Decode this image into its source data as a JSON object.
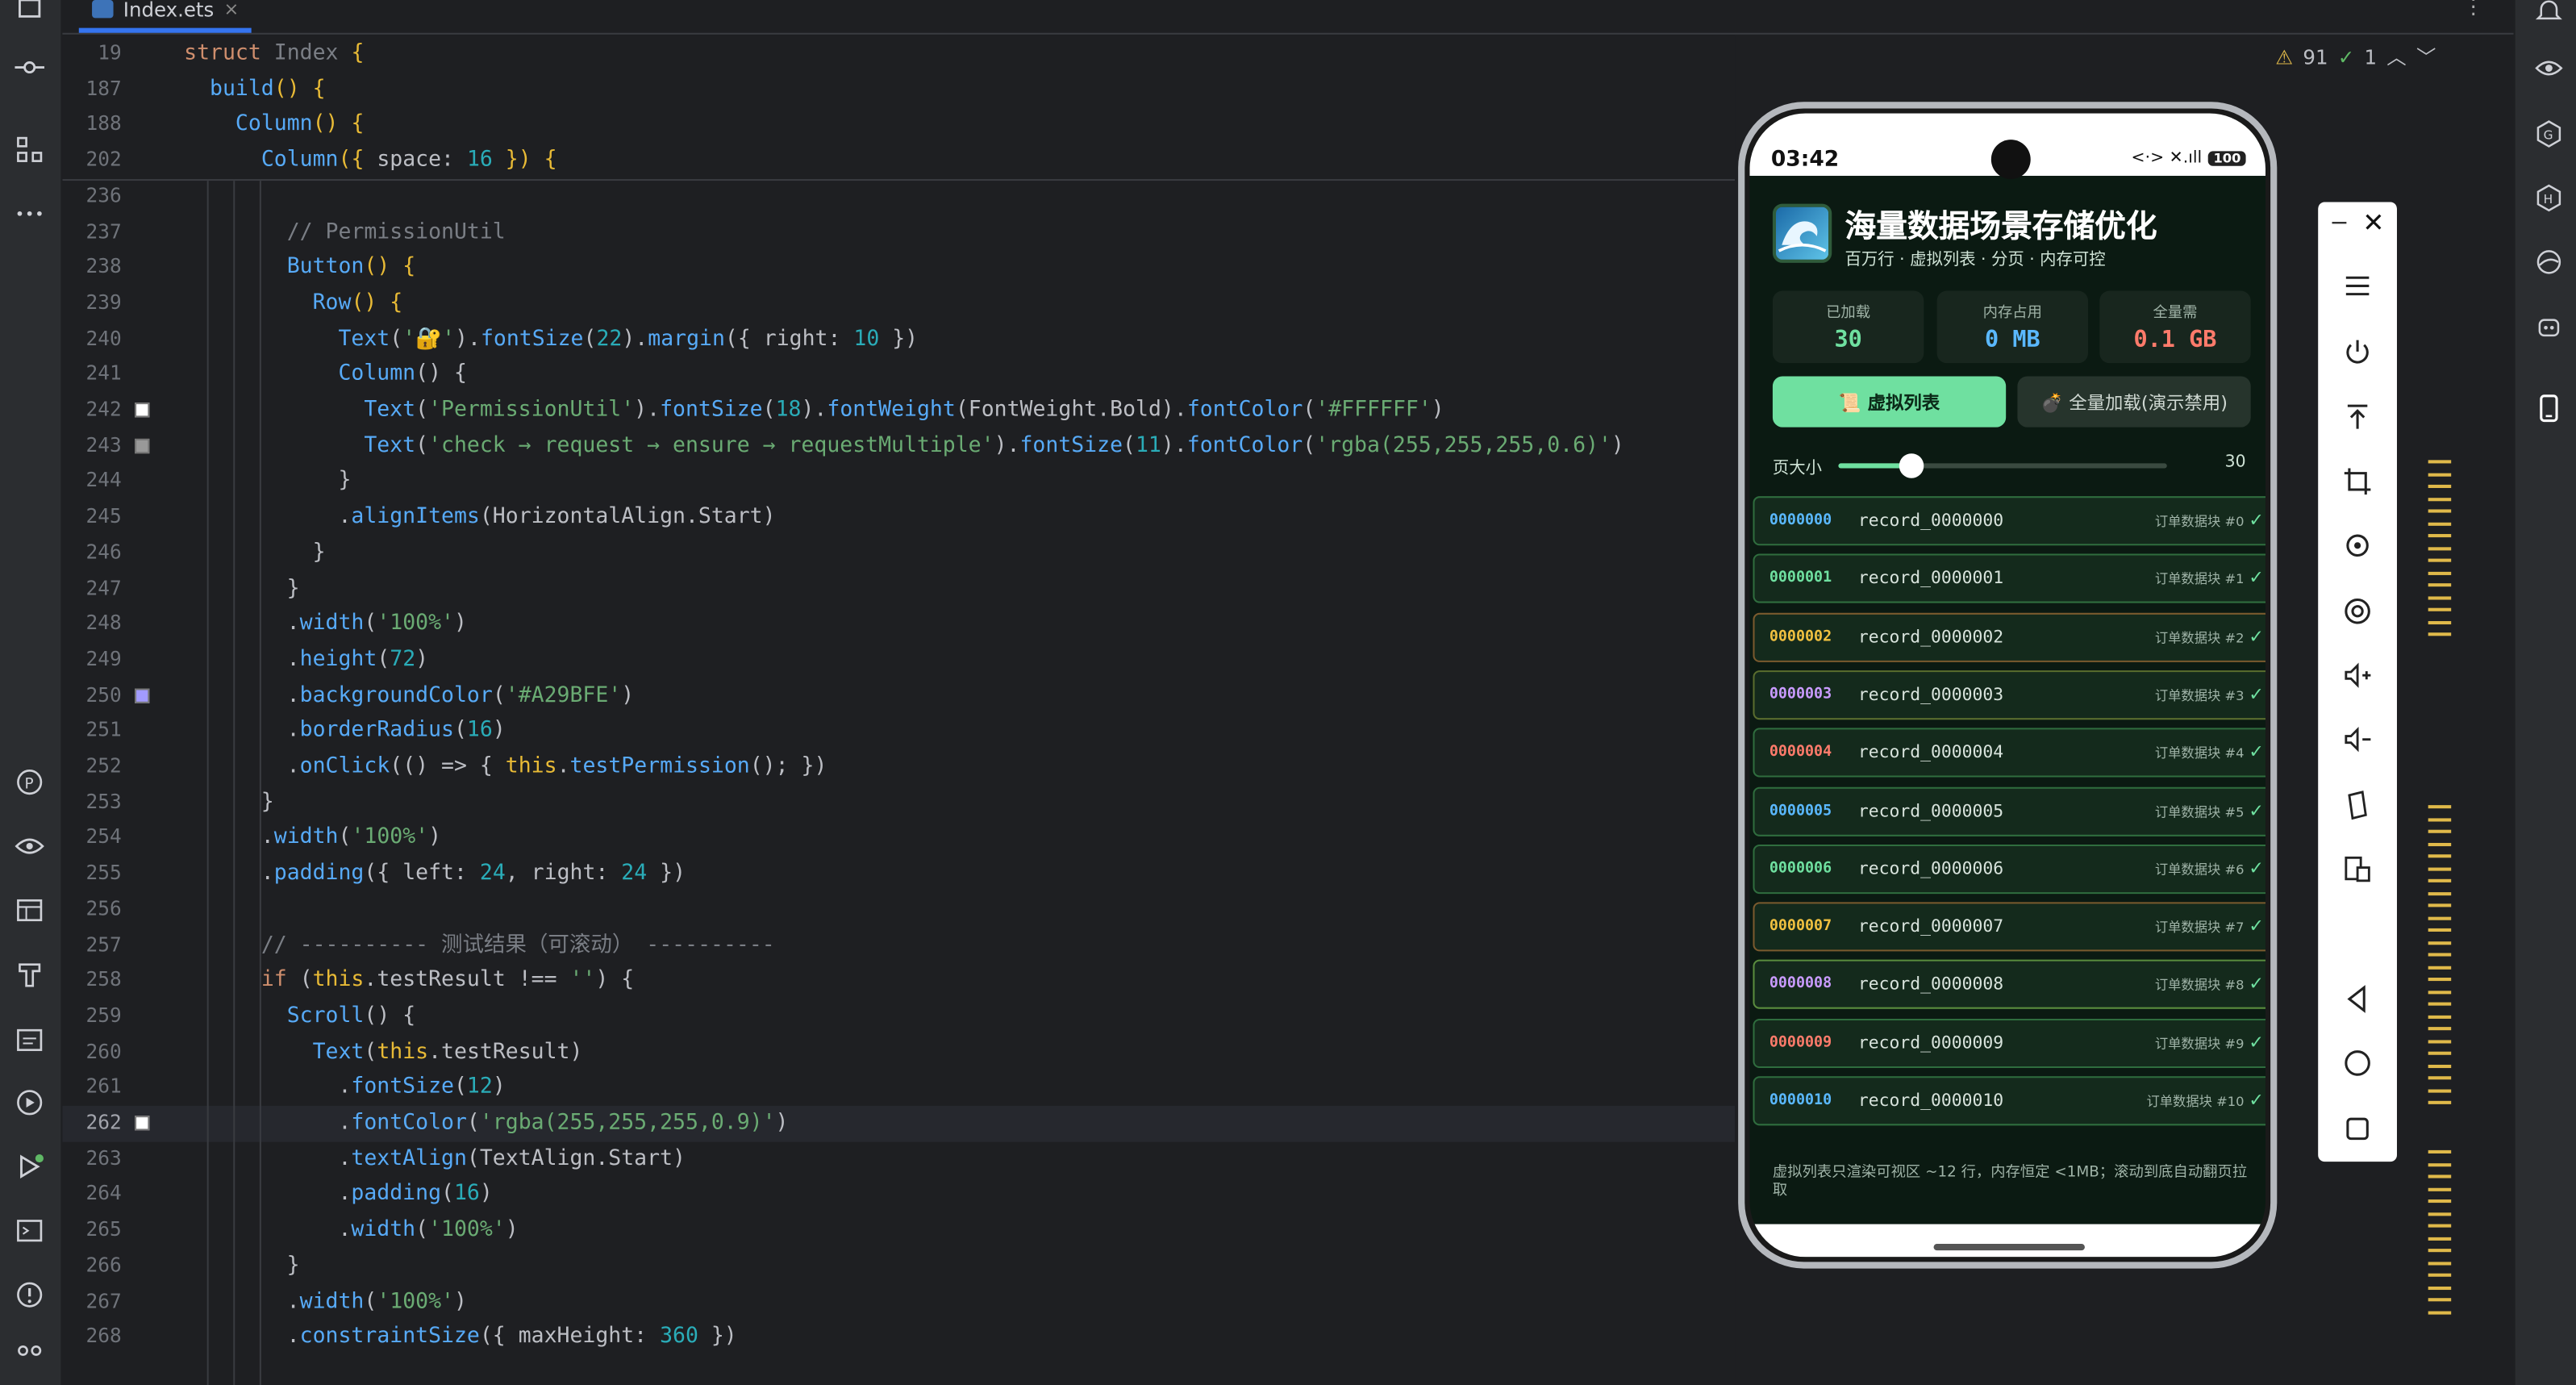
{
  "window": {
    "tab_label": "Index.ets",
    "tab_close": "×",
    "more": "⋮"
  },
  "inspections": {
    "warnings": "91",
    "ok": "1"
  },
  "code_lines": [
    {
      "no": "19",
      "html": "<span class='k'>struct</span> <span class='t'>Index</span> <span class='y'>{</span>"
    },
    {
      "no": "187",
      "html": "  <span class='f'>build</span><span class='y'>()</span> <span class='y'>{</span>"
    },
    {
      "no": "188",
      "html": "    <span class='f'>Column</span><span class='y'>()</span> <span class='y'>{</span>"
    },
    {
      "no": "202",
      "html": "      <span class='f'>Column</span><span class='y'>({</span> space: <span class='n'>16</span> <span class='y'>})</span> <span class='y'>{</span>"
    },
    {
      "no": "236",
      "html": ""
    },
    {
      "no": "237",
      "html": "        <span class='c'>// PermissionUtil</span>"
    },
    {
      "no": "238",
      "html": "        <span class='f'>Button</span><span class='y'>()</span> <span class='y'>{</span>"
    },
    {
      "no": "239",
      "html": "          <span class='f'>Row</span><span class='y'>()</span> <span class='y'>{</span>"
    },
    {
      "no": "240",
      "html": "            <span class='f'>Text</span>(<span class='s'>'🔐'</span>).<span class='f'>fontSize</span>(<span class='n'>22</span>).<span class='f'>margin</span>({ right: <span class='n'>10</span> })"
    },
    {
      "no": "241",
      "html": "            <span class='f'>Column</span>() {"
    },
    {
      "no": "242",
      "html": "              <span class='f'>Text</span>(<span class='s'>'PermissionUtil'</span>).<span class='f'>fontSize</span>(<span class='n'>18</span>).<span class='f'>fontWeight</span>(FontWeight.Bold).<span class='f'>fontColor</span>(<span class='s'>'#FFFFFF'</span>)"
    },
    {
      "no": "243",
      "html": "              <span class='f'>Text</span>(<span class='s'>'check → request → ensure → requestMultiple'</span>).<span class='f'>fontSize</span>(<span class='n'>11</span>).<span class='f'>fontColor</span>(<span class='s'>'rgba(255,255,255,0.6)'</span>)"
    },
    {
      "no": "244",
      "html": "            }"
    },
    {
      "no": "245",
      "html": "            .<span class='f'>alignItems</span>(HorizontalAlign.Start)"
    },
    {
      "no": "246",
      "html": "          }"
    },
    {
      "no": "247",
      "html": "        }"
    },
    {
      "no": "248",
      "html": "        .<span class='f'>width</span>(<span class='s'>'100%'</span>)"
    },
    {
      "no": "249",
      "html": "        .<span class='f'>height</span>(<span class='n'>72</span>)"
    },
    {
      "no": "250",
      "html": "        .<span class='f'>backgroundColor</span>(<span class='s'>'#A29BFE'</span>)"
    },
    {
      "no": "251",
      "html": "        .<span class='f'>borderRadius</span>(<span class='n'>16</span>)"
    },
    {
      "no": "252",
      "html": "        .<span class='f'>onClick</span>(() => { <span class='y'>this</span>.<span class='f'>testPermission</span>(); })"
    },
    {
      "no": "253",
      "html": "      }"
    },
    {
      "no": "254",
      "html": "      .<span class='f'>width</span>(<span class='s'>'100%'</span>)"
    },
    {
      "no": "255",
      "html": "      .<span class='f'>padding</span>({ left: <span class='n'>24</span>, right: <span class='n'>24</span> })"
    },
    {
      "no": "256",
      "html": ""
    },
    {
      "no": "257",
      "html": "      <span class='c'>// ---------- 测试结果（可滚动） ----------</span>"
    },
    {
      "no": "258",
      "html": "      <span class='k'>if</span> (<span class='y'>this</span>.testResult !== <span class='s'>''</span>) {"
    },
    {
      "no": "259",
      "html": "        <span class='f'>Scroll</span>() {"
    },
    {
      "no": "260",
      "html": "          <span class='f'>Text</span>(<span class='y'>this</span>.testResult)"
    },
    {
      "no": "261",
      "html": "            .<span class='f'>fontSize</span>(<span class='n'>12</span>)"
    },
    {
      "no": "262",
      "html": "            .<span class='f'>fontColor</span>(<span class='s'>'rgba(255,255,255,0.9)'</span>)"
    },
    {
      "no": "263",
      "html": "            .<span class='f'>textAlign</span>(TextAlign.Start)"
    },
    {
      "no": "264",
      "html": "            .<span class='f'>padding</span>(<span class='n'>16</span>)"
    },
    {
      "no": "265",
      "html": "            .<span class='f'>width</span>(<span class='s'>'100%'</span>)"
    },
    {
      "no": "266",
      "html": "        }"
    },
    {
      "no": "267",
      "html": "        .<span class='f'>width</span>(<span class='s'>'100%'</span>)"
    },
    {
      "no": "268",
      "html": "        .<span class='f'>constraintSize</span>({ maxHeight: <span class='n'>360</span> })"
    }
  ],
  "gutter_colors": {
    "242": "#FFFFFF",
    "243": "#999999",
    "250": "#A29BFE",
    "262": "#FFFFFF"
  },
  "current_line": "262",
  "phone": {
    "time": "03:42",
    "battery": "100",
    "net": "<·> ✕.ıll",
    "title": "海量数据场景存储优化",
    "subtitle": "百万行 · 虚拟列表 · 分页 · 内存可控",
    "stats": [
      {
        "label": "已加载",
        "value": "30",
        "color": "#6fe0a0"
      },
      {
        "label": "内存占用",
        "value": "0 MB",
        "color": "#5ab8ff"
      },
      {
        "label": "全量需",
        "value": "0.1 GB",
        "color": "#ff7b6b"
      }
    ],
    "btn_virtual": "📜 虚拟列表",
    "btn_full": "💣 全量加载(演示禁用)",
    "page_size_label": "页大小",
    "page_size_value": "30",
    "page_size_fraction": 0.22,
    "rows": [
      {
        "id": "0000000",
        "name": "record_0000000",
        "tag": "订单数据块 #0",
        "check": "✓",
        "color": "#5ab8ff",
        "border": "#2f6d3e"
      },
      {
        "id": "0000001",
        "name": "record_0000001",
        "tag": "订单数据块 #1",
        "check": "✓",
        "color": "#6fe0a0",
        "border": "#2f6d3e"
      },
      {
        "id": "0000002",
        "name": "record_0000002",
        "tag": "订单数据块 #2",
        "check": "✓",
        "color": "#f0c040",
        "border": "#7a5a2e"
      },
      {
        "id": "0000003",
        "name": "record_0000003",
        "tag": "订单数据块 #3",
        "check": "✓",
        "color": "#c99bff",
        "border": "#5a6d2e"
      },
      {
        "id": "0000004",
        "name": "record_0000004",
        "tag": "订单数据块 #4",
        "check": "✓",
        "color": "#ff7b6b",
        "border": "#2f6d3e"
      },
      {
        "id": "0000005",
        "name": "record_0000005",
        "tag": "订单数据块 #5",
        "check": "✓",
        "color": "#5ab8ff",
        "border": "#2f6d3e"
      },
      {
        "id": "0000006",
        "name": "record_0000006",
        "tag": "订单数据块 #6",
        "check": "✓",
        "color": "#6fe0a0",
        "border": "#2f6d3e"
      },
      {
        "id": "0000007",
        "name": "record_0000007",
        "tag": "订单数据块 #7",
        "check": "✓",
        "color": "#f0c040",
        "border": "#7a5a2e"
      },
      {
        "id": "0000008",
        "name": "record_0000008",
        "tag": "订单数据块 #8",
        "check": "✓",
        "color": "#c99bff",
        "border": "#5a8d3e"
      },
      {
        "id": "0000009",
        "name": "record_0000009",
        "tag": "订单数据块 #9",
        "check": "✓",
        "color": "#ff7b6b",
        "border": "#2f6d3e"
      },
      {
        "id": "0000010",
        "name": "record_0000010",
        "tag": "订单数据块 #10",
        "check": "✓",
        "color": "#5ab8ff",
        "border": "#2f6d3e"
      }
    ],
    "footnote": "虚拟列表只渲染可视区 ~12 行，内存恒定 <1MB；滚动到底自动翻页拉取"
  },
  "emulator": {
    "minimize": "−",
    "close": "✕"
  },
  "icons": {
    "left": [
      "frame-icon",
      "commit-icon",
      "structure-icon",
      "more-icon",
      "plugin-icon",
      "eye-scan-icon",
      "table-icon",
      "build-icon",
      "calendar-icon",
      "run-config-icon",
      "run-icon",
      "terminal-icon",
      "problems-icon",
      "vcs-icon"
    ],
    "right": [
      "notifications-icon",
      "eye-icon",
      "g-icon",
      "h-icon",
      "leaf-icon",
      "robot-icon",
      "device-icon"
    ],
    "emulator": [
      "menu-icon",
      "power-icon",
      "top-icon",
      "crop-icon",
      "rotate-icon",
      "screenshot-icon",
      "volume-up-icon",
      "volume-down-icon",
      "fold-icon",
      "multi-device-icon",
      "back-icon",
      "home-icon",
      "recents-icon"
    ]
  }
}
